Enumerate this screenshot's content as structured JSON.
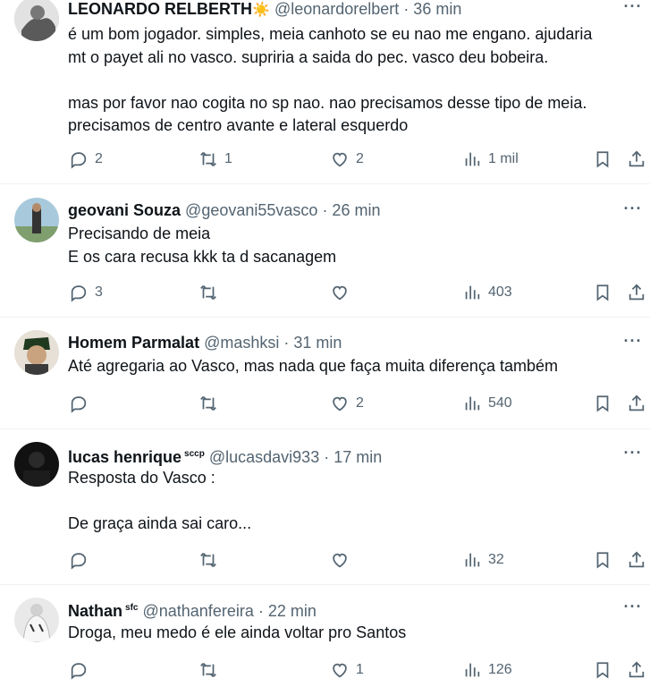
{
  "tweets": [
    {
      "name": "LEONARDO RELBERTH",
      "emoji": "☀️",
      "handle": "@leonardorelbert",
      "time": "· 36 min",
      "lines": [
        "é um bom jogador. simples, meia canhoto se eu nao me engano. ajudaria",
        "mt o payet ali no vasco. supriria a saida do pec. vasco deu bobeira.",
        "",
        "mas por favor nao cogita no sp nao. nao precisamos desse tipo de meia.",
        "precisamos de centro avante e lateral esquerdo"
      ],
      "replies": "2",
      "retweets": "1",
      "likes": "2",
      "views": "1 mil"
    },
    {
      "name": "geovani Souza",
      "handle": "@geovani55vasco",
      "time": "· 26 min",
      "lines": [
        "Precisando de meia",
        "E os cara recusa kkk ta d sacanagem"
      ],
      "replies": "3",
      "retweets": "",
      "likes": "",
      "views": "403"
    },
    {
      "name": "Homem Parmalat",
      "handle": "@mashksi",
      "time": "· 31 min",
      "lines": [
        "Até agregaria ao Vasco, mas nada que faça muita diferença também"
      ],
      "replies": "",
      "retweets": "",
      "likes": "2",
      "views": "540"
    },
    {
      "name": "lucas henrique",
      "badge": "sccp",
      "handle": "@lucasdavi933",
      "time": "· 17 min",
      "lines": [
        "Resposta do Vasco :",
        "",
        "De graça ainda sai caro..."
      ],
      "replies": "",
      "retweets": "",
      "likes": "",
      "views": "32"
    },
    {
      "name": "Nathan",
      "badge": "sfc",
      "handle": "@nathanfereira",
      "time": "· 22 min",
      "lines": [
        "Droga, meu medo é ele ainda voltar pro Santos"
      ],
      "replies": "",
      "retweets": "",
      "likes": "1",
      "views": "126"
    }
  ],
  "icons": {
    "reply": "reply-icon",
    "retweet": "retweet-icon",
    "like": "like-icon",
    "views": "views-icon",
    "bookmark": "bookmark-icon",
    "share": "share-icon",
    "more": "more-icon"
  },
  "colors": {
    "text": "#0f1419",
    "secondary": "#536471",
    "divider": "#eff3f4"
  }
}
